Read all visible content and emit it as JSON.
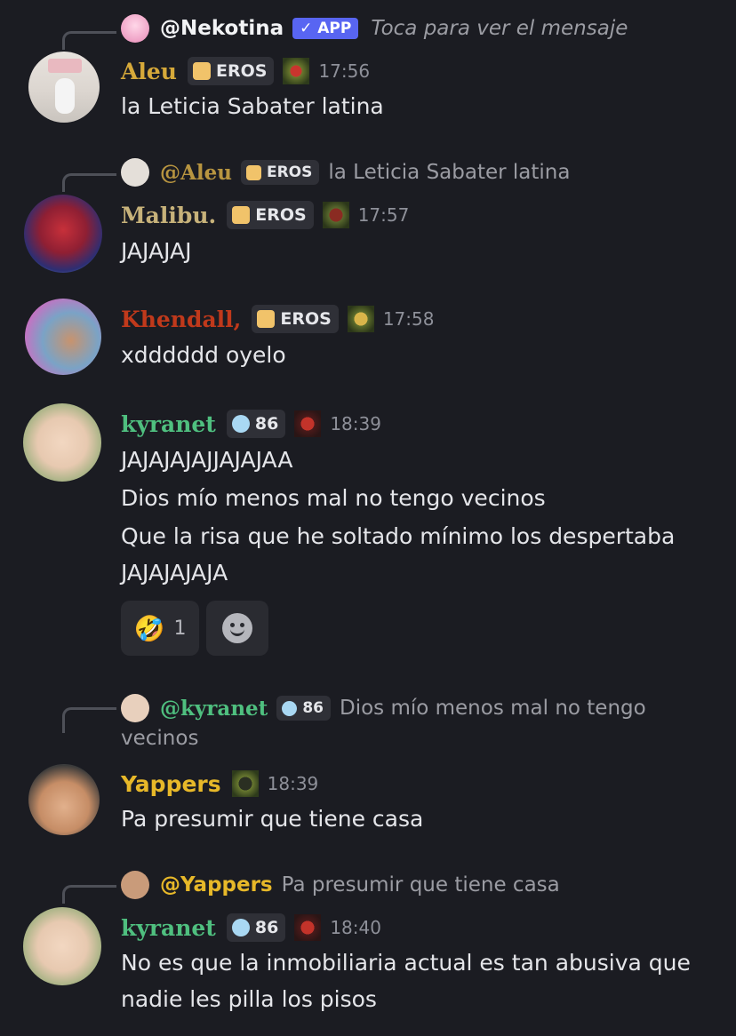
{
  "messages": [
    {
      "reply": {
        "name": "@Nekotina",
        "app_badge": "✓ APP",
        "text": "Toca para ver el mensaje"
      },
      "author": "Aleu",
      "author_color": "#d6a93a",
      "tag": "EROS",
      "time": "17:56",
      "lines": [
        "la Leticia Sabater latina"
      ]
    },
    {
      "reply": {
        "name": "@Aleu",
        "tag": "EROS",
        "text": "la Leticia Sabater latina"
      },
      "author": "Malibu.",
      "author_color": "#c7b27a",
      "tag": "EROS",
      "time": "17:57",
      "lines": [
        "JAJAJAJ"
      ]
    },
    {
      "author": "Khendall,",
      "author_color": "#c0391b",
      "tag": "EROS",
      "time": "17:58",
      "lines": [
        "xdddddd oyelo"
      ]
    },
    {
      "author": "kyranet",
      "author_color": "#4fbf7f",
      "tag": "86",
      "time": "18:39",
      "lines": [
        "JAJAJAJAJJAJAJAA",
        "Dios mío menos mal no tengo vecinos",
        "Que la risa que he soltado mínimo los despertaba",
        "JAJAJAJAJA"
      ],
      "reactions": [
        {
          "emoji": "🤣",
          "count": "1"
        }
      ]
    },
    {
      "reply": {
        "name": "@kyranet",
        "tag": "86",
        "text": "Dios mío menos mal no tengo",
        "text2": "vecinos"
      },
      "author": "Yappers",
      "author_color": "#e7b829",
      "time": "18:39",
      "lines": [
        "Pa presumir que tiene casa"
      ]
    },
    {
      "reply": {
        "name": "@Yappers",
        "text": "Pa presumir que tiene casa"
      },
      "author": "kyranet",
      "author_color": "#4fbf7f",
      "tag": "86",
      "time": "18:40",
      "lines": [
        "No es que la inmobiliaria actual es tan abusiva que",
        "nadie les pilla los pisos"
      ]
    }
  ],
  "colors": {
    "background": "#1b1c22",
    "tag_bg": "#2f3037",
    "app_badge": "#5865f2",
    "nekotina": "#f2f3f5"
  }
}
